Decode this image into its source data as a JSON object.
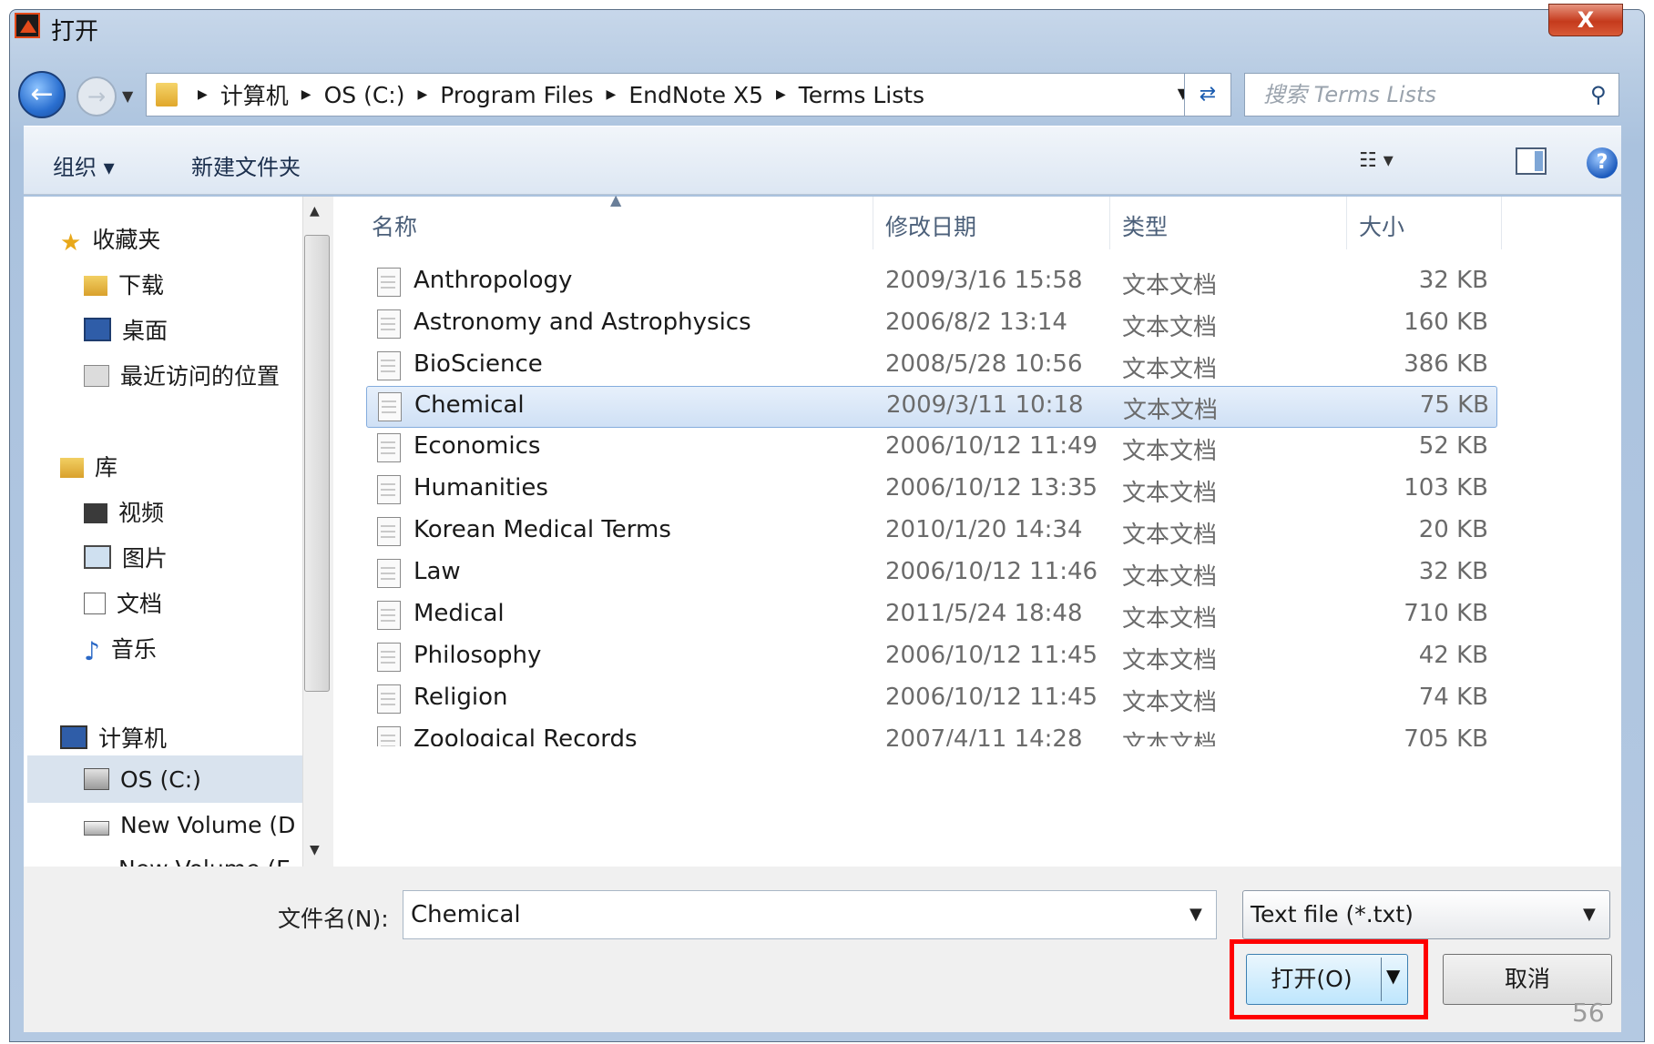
{
  "window": {
    "title": "打开",
    "close_label": "X"
  },
  "address": {
    "segments": [
      "计算机",
      "OS (C:)",
      "Program Files",
      "EndNote X5",
      "Terms Lists"
    ],
    "search_placeholder": "搜索 Terms Lists"
  },
  "toolbar": {
    "organize": "组织 ▾",
    "new_folder": "新建文件夹",
    "views_glyph": "☷ ▾"
  },
  "nav": {
    "favorites_header": "收藏夹",
    "favorites": [
      "下载",
      "桌面",
      "最近访问的位置"
    ],
    "libraries_header": "库",
    "libraries": [
      "视频",
      "图片",
      "文档",
      "音乐"
    ],
    "computer_header": "计算机",
    "drives": [
      "OS (C:)",
      "New Volume (D",
      "New Volume (E"
    ]
  },
  "columns": {
    "name": "名称",
    "modified": "修改日期",
    "type": "类型",
    "size": "大小"
  },
  "files": [
    {
      "name": "Anthropology",
      "modified": "2009/3/16 15:58",
      "type": "文本文档",
      "size": "32 KB"
    },
    {
      "name": "Astronomy and Astrophysics",
      "modified": "2006/8/2 13:14",
      "type": "文本文档",
      "size": "160 KB"
    },
    {
      "name": "BioScience",
      "modified": "2008/5/28 10:56",
      "type": "文本文档",
      "size": "386 KB"
    },
    {
      "name": "Chemical",
      "modified": "2009/3/11 10:18",
      "type": "文本文档",
      "size": "75 KB"
    },
    {
      "name": "Economics",
      "modified": "2006/10/12 11:49",
      "type": "文本文档",
      "size": "52 KB"
    },
    {
      "name": "Humanities",
      "modified": "2006/10/12 13:35",
      "type": "文本文档",
      "size": "103 KB"
    },
    {
      "name": "Korean Medical Terms",
      "modified": "2010/1/20 14:34",
      "type": "文本文档",
      "size": "20 KB"
    },
    {
      "name": "Law",
      "modified": "2006/10/12 11:46",
      "type": "文本文档",
      "size": "32 KB"
    },
    {
      "name": "Medical",
      "modified": "2011/5/24 18:48",
      "type": "文本文档",
      "size": "710 KB"
    },
    {
      "name": "Philosophy",
      "modified": "2006/10/12 11:45",
      "type": "文本文档",
      "size": "42 KB"
    },
    {
      "name": "Religion",
      "modified": "2006/10/12 11:45",
      "type": "文本文档",
      "size": "74 KB"
    },
    {
      "name": "Zoological Records",
      "modified": "2007/4/11 14:28",
      "type": "文本文档",
      "size": "705 KB"
    }
  ],
  "selected_file": "Chemical",
  "footer": {
    "filename_label": "文件名(N):",
    "filename_value": "Chemical",
    "filter_value": "Text file  (*.txt)",
    "open_label": "打开(O)",
    "cancel_label": "取消",
    "page_number": "56"
  },
  "colors": {
    "highlight": "#ff0000",
    "selection": "#cfe0f5"
  }
}
